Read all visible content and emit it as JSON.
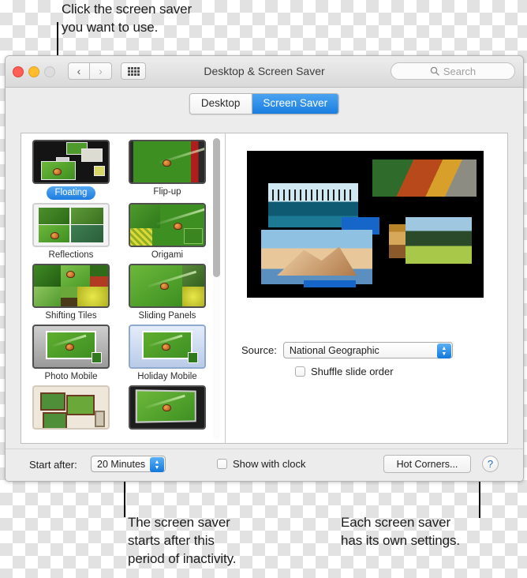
{
  "annotations": {
    "top": "Click the screen saver\nyou want to use.",
    "bottom_left": "The screen saver\nstarts after this\nperiod of inactivity.",
    "bottom_right": "Each screen saver\nhas its own settings."
  },
  "window": {
    "title": "Desktop & Screen Saver",
    "traffic_lights": {
      "close": "close-button",
      "minimize": "minimize-button",
      "zoom": "zoom-button"
    },
    "nav": {
      "back": "‹",
      "forward": "›",
      "grid": "show-all-icon"
    },
    "search": {
      "placeholder": "Search",
      "icon": "search-icon"
    }
  },
  "tabs": [
    {
      "label": "Desktop",
      "selected": false
    },
    {
      "label": "Screen Saver",
      "selected": true
    }
  ],
  "screensavers": [
    {
      "label": "Floating",
      "selected": true,
      "style": "floating"
    },
    {
      "label": "Flip-up",
      "selected": false,
      "style": "flip"
    },
    {
      "label": "Reflections",
      "selected": false,
      "style": "reflect"
    },
    {
      "label": "Origami",
      "selected": false,
      "style": "origami"
    },
    {
      "label": "Shifting Tiles",
      "selected": false,
      "style": "tiles"
    },
    {
      "label": "Sliding Panels",
      "selected": false,
      "style": "panels"
    },
    {
      "label": "Photo Mobile",
      "selected": false,
      "style": "mobile"
    },
    {
      "label": "Holiday Mobile",
      "selected": false,
      "style": "holiday"
    },
    {
      "label": "",
      "selected": false,
      "style": "wall"
    },
    {
      "label": "",
      "selected": false,
      "style": "vintage"
    }
  ],
  "settings": {
    "source_label": "Source:",
    "source_value": "National Geographic",
    "shuffle_label": "Shuffle slide order",
    "shuffle_checked": false
  },
  "bottom_bar": {
    "start_after_label": "Start after:",
    "start_after_value": "20 Minutes",
    "show_clock_label": "Show with clock",
    "show_clock_checked": false,
    "hot_corners_label": "Hot Corners...",
    "help_label": "?"
  },
  "colors": {
    "accent": "#1a7ee0",
    "selected_tab": "#1a7ee0",
    "window_chrome": "#ececec",
    "help_blue": "#2c69b5"
  }
}
